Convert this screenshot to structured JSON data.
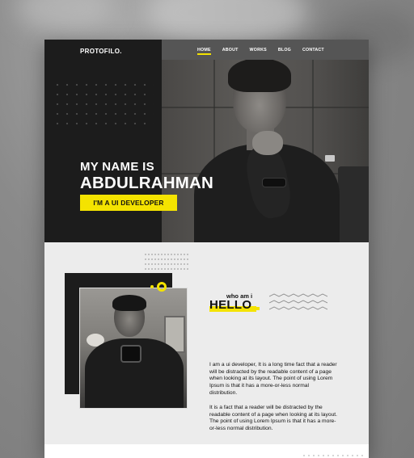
{
  "brand": "PROTOFILO.",
  "nav": {
    "items": [
      "HOME",
      "ABOUT",
      "WORKS",
      "BLOG",
      "CONTACT"
    ],
    "active": "HOME"
  },
  "hero": {
    "line1": "MY NAME IS",
    "line2": "ABDULRAHMAN",
    "role": "I'M A UI DEVELOPER"
  },
  "about": {
    "kicker": "who am i",
    "heading": "HELLO",
    "paragraph1": "I am a ui developer, It is a long time fact that a reader will be distracted by the readable content of a page when looking at its layout. The point of using Lorem Ipsum is that it has a more-or-less normal distribution.",
    "paragraph2": "It is a fact that a reader will be distracted by the readable content of a page when looking at its layout. The point of using Lorem Ipsum is that it has a more-or-less normal distribution."
  },
  "colors": {
    "accent": "#f4e300",
    "dark": "#1c1c1c",
    "light": "#ececec"
  }
}
